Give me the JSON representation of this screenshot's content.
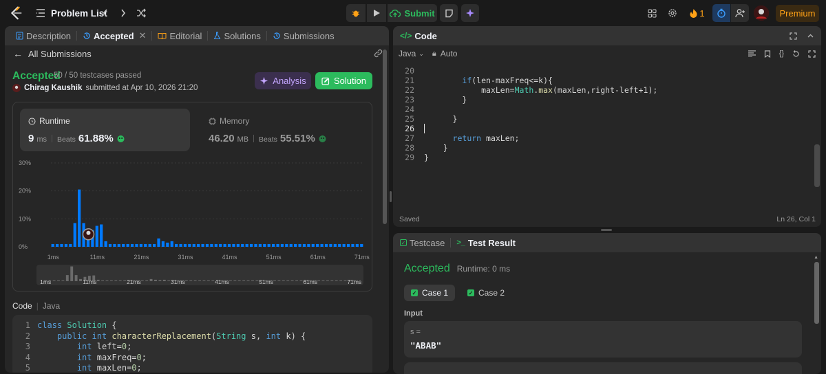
{
  "header": {
    "problem_list_label": "Problem List",
    "submit_label": "Submit",
    "streak_count": "1",
    "premium_label": "Premium"
  },
  "left_panel": {
    "tabs": [
      {
        "label": "Description"
      },
      {
        "label": "Accepted"
      },
      {
        "label": "Editorial"
      },
      {
        "label": "Solutions"
      },
      {
        "label": "Submissions"
      }
    ],
    "back_label": "All Submissions",
    "status": "Accepted",
    "testcases": "50 / 50 testcases passed",
    "user": "Chirag Kaushik",
    "submitted_text": "submitted at Apr 10, 2026 21:20",
    "analysis_label": "Analysis",
    "solution_label": "Solution",
    "runtime": {
      "label": "Runtime",
      "value": "9",
      "unit": "ms",
      "beats_label": "Beats",
      "percent": "61.88%"
    },
    "memory": {
      "label": "Memory",
      "value": "46.20",
      "unit": "MB",
      "beats_label": "Beats",
      "percent": "55.51%"
    },
    "code_label": "Code",
    "lang_label": "Java",
    "code_lines": [
      {
        "num": "1",
        "text": "class Solution {"
      },
      {
        "num": "2",
        "text": "    public int characterReplacement(String s, int k) {"
      },
      {
        "num": "3",
        "text": "        int left=0;"
      },
      {
        "num": "4",
        "text": "        int maxFreq=0;"
      },
      {
        "num": "5",
        "text": "        int maxLen=0;"
      }
    ]
  },
  "chart_data": {
    "type": "bar",
    "ylabel_ticks": [
      "30%",
      "20%",
      "10%",
      "0%"
    ],
    "xtick_labels": [
      "1ms",
      "11ms",
      "21ms",
      "31ms",
      "41ms",
      "51ms",
      "61ms",
      "71ms"
    ],
    "ylim": [
      0,
      30
    ],
    "x": [
      1,
      2,
      3,
      4,
      5,
      6,
      7,
      8,
      9,
      10,
      11,
      12,
      13,
      14,
      15,
      16,
      17,
      18,
      19,
      20,
      21,
      22,
      23,
      24,
      25,
      26,
      27,
      28,
      29,
      30,
      31,
      32,
      33,
      34,
      35,
      36,
      37,
      38,
      39,
      40,
      41,
      42,
      43,
      44,
      45,
      46,
      47,
      48,
      49,
      50,
      51,
      52,
      53,
      54,
      55,
      56,
      57,
      58,
      59,
      60,
      61,
      62,
      63,
      64,
      65,
      66,
      67,
      68,
      69,
      70,
      71
    ],
    "values": [
      1.0,
      1.0,
      1.0,
      1.0,
      1.0,
      8.5,
      20.5,
      8.5,
      3.0,
      6.0,
      7.5,
      8.0,
      2.0,
      1.0,
      1.0,
      1.0,
      1.0,
      1.0,
      1.0,
      1.0,
      1.0,
      1.0,
      1.0,
      1.0,
      3.0,
      2.0,
      1.5,
      2.0,
      1.0,
      1.0,
      1.0,
      1.0,
      1.0,
      1.0,
      1.0,
      1.0,
      1.0,
      1.0,
      1.0,
      1.0,
      1.0,
      1.0,
      1.0,
      1.0,
      1.0,
      1.0,
      1.0,
      1.0,
      1.0,
      1.0,
      1.0,
      1.0,
      1.0,
      1.0,
      1.0,
      1.0,
      1.0,
      1.0,
      1.0,
      1.0,
      1.0,
      1.0,
      1.0,
      1.0,
      1.0,
      1.0,
      1.0,
      1.0,
      1.0,
      1.0,
      1.0
    ],
    "highlight_x": 9,
    "colors": {
      "bar": "#007aff",
      "grid": "#3a3a3a"
    }
  },
  "code_panel": {
    "title": "Code",
    "language": "Java",
    "mode": "Auto",
    "lines": [
      {
        "num": "20",
        "text": ""
      },
      {
        "num": "21",
        "text": "        if(len-maxFreq<=k){"
      },
      {
        "num": "22",
        "text": "            maxLen=Math.max(maxLen,right-left+1);"
      },
      {
        "num": "23",
        "text": "        }"
      },
      {
        "num": "24",
        "text": ""
      },
      {
        "num": "25",
        "text": "      }"
      },
      {
        "num": "26",
        "text": ""
      },
      {
        "num": "27",
        "text": "      return maxLen;"
      },
      {
        "num": "28",
        "text": "    }"
      },
      {
        "num": "29",
        "text": "}"
      }
    ],
    "saved_label": "Saved",
    "cursor_label": "Ln 26, Col 1"
  },
  "test_panel": {
    "tabs": [
      {
        "label": "Testcase"
      },
      {
        "label": "Test Result"
      }
    ],
    "result": "Accepted",
    "runtime_text": "Runtime: 0 ms",
    "cases": [
      {
        "label": "Case 1"
      },
      {
        "label": "Case 2"
      }
    ],
    "input_label": "Input",
    "var_name": "s =",
    "var_value": "\"ABAB\""
  },
  "colors": {
    "accent_green": "#2cbb5d",
    "premium_orange": "#ffa116",
    "chart_blue": "#007aff"
  }
}
